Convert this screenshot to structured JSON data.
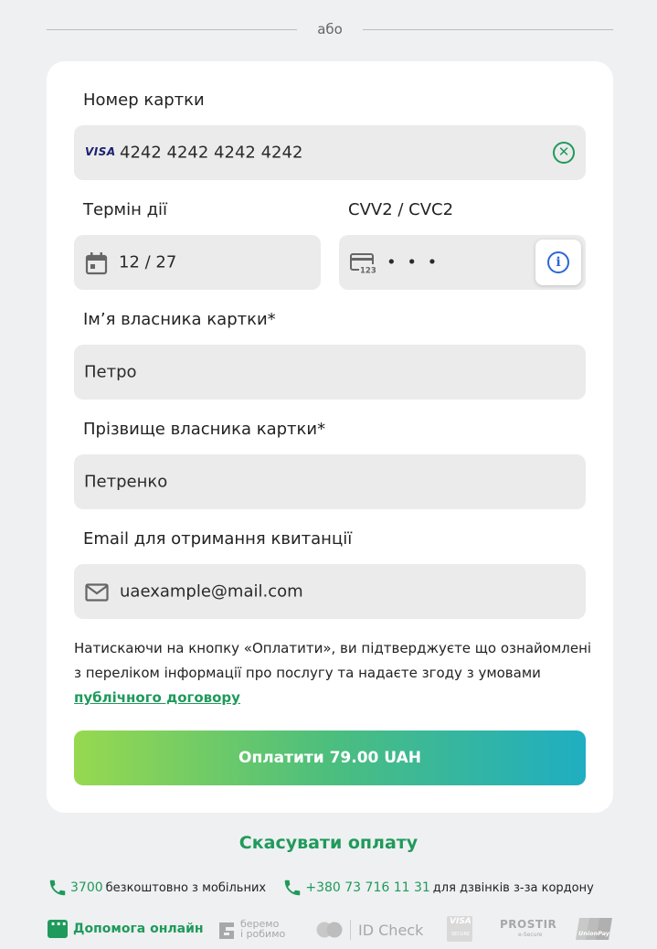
{
  "divider": {
    "text": "або"
  },
  "form": {
    "card_number": {
      "label": "Номер картки",
      "value": "4242 4242 4242 4242",
      "brand": "VISA"
    },
    "expiry": {
      "label": "Термін дії",
      "value": "12 / 27"
    },
    "cvv": {
      "label": "CVV2 / CVC2",
      "value": "• • •",
      "icon_text": "123"
    },
    "first_name": {
      "label": "Ім’я власника картки*",
      "value": "Петро"
    },
    "last_name": {
      "label": "Прізвище власника картки*",
      "value": "Петренко"
    },
    "email": {
      "label": "Email для отримання квитанції",
      "value": "uaexample@mail.com"
    },
    "notice_text": "Натискаючи на кнопку «Оплатити», ви підтверджуєте що ознайомлені з переліком інформації про послугу та надаєте згоду з умовами",
    "notice_link": "публічного договору",
    "pay_button": "Оплатити 79.00 UAH"
  },
  "cancel_label": "Скасувати оплату",
  "contacts": [
    {
      "number": "3700",
      "description": "безкоштовно з мобільних"
    },
    {
      "number": "+380 73 716 11 31",
      "description": "для дзвінків з-за кордону"
    }
  ],
  "help_label": "Допомога онлайн",
  "footer_logos": {
    "beremo": "берemo\nі робимо",
    "beremo_line1": "беремо",
    "beremo_line2": "і робимо",
    "idcheck": "ID Check",
    "visa_secure": "VISA",
    "visa_secure_sub": "SECURE",
    "prostir": "PROSTIR",
    "prostir_sub": "e-Secure",
    "unionpay": "UnionPay"
  },
  "colors": {
    "accent": "#1f9a5b",
    "info": "#2a66d9",
    "field_bg": "#ebebeb",
    "page_bg": "#eff0f2"
  }
}
